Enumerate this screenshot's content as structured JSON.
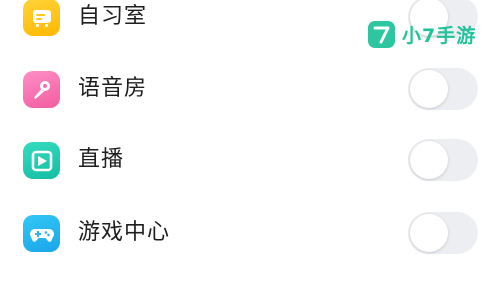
{
  "settings": {
    "items": [
      {
        "label": "自习室",
        "icon": "study-room-icon",
        "color": "#FFC61A",
        "enabled": false
      },
      {
        "label": "语音房",
        "icon": "microphone-icon",
        "color": "#F873B2",
        "enabled": false
      },
      {
        "label": "直播",
        "icon": "live-stream-icon",
        "color": "#22CCB0",
        "enabled": false
      },
      {
        "label": "游戏中心",
        "icon": "gamepad-icon",
        "color": "#27B6F0",
        "enabled": false
      }
    ]
  },
  "watermark": {
    "badge_text": "7",
    "text": "小7手游",
    "color": "#22C39A"
  }
}
